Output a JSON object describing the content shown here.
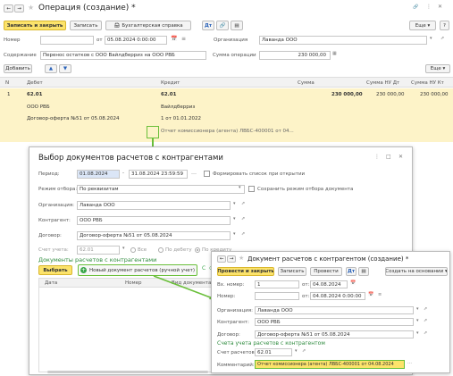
{
  "main": {
    "title": "Операция (создание) *",
    "nav": {
      "back": "←",
      "forward": "→",
      "star": "★"
    },
    "window_icons": {
      "link": "🔗",
      "more": "⋮",
      "close": "✕"
    },
    "toolbar": {
      "save_close": "Записать и закрыть",
      "save": "Записать",
      "acc_ref": "Бухгалтерская справка",
      "more": "Еще",
      "help": "?"
    },
    "number_label": "Номер",
    "from_label": "от",
    "date_value": "05.08.2024 0:00:00",
    "org_label": "Организация",
    "org_value": "Лаванда ООО",
    "content_label": "Содержание",
    "content_value": "Перенос остатков с ООО Вайлдберриз на ООО РВБ",
    "amount_label": "Сумма операции",
    "amount_value": "230 000,00",
    "add_button": "Добавить",
    "more2": "Еще",
    "table": {
      "headers": [
        "N",
        "Дебет",
        "Кредит",
        "Сумма",
        "Сумма НУ Дт",
        "Сумма НУ Кт"
      ],
      "row": {
        "n": "1",
        "debit": [
          "62.01",
          "ООО РВБ",
          "Договор-оферта №51 от 05.08.2024"
        ],
        "credit": [
          "62.01",
          "Вайлдберриз",
          "1 от 01.01.2022",
          "Отчет комиссионера (агента) ЛВБС-400001 от 04..."
        ],
        "sum": "230 000,00",
        "sum_dt": "230 000,00",
        "sum_kt": "230 000,00"
      }
    }
  },
  "dialog": {
    "title": "Выбор документов расчетов с контрагентами",
    "period_label": "Период:",
    "period_from": "01.08.2024",
    "period_to": "31.08.2024 23:59:59",
    "form_list_label": "Формировать список при открытии",
    "mode_label": "Режим отбора:",
    "mode_value": "По реквизитам",
    "save_mode_label": "Сохранить режим отбора документа",
    "org_label": "Организация:",
    "org_value": "Лаванда ООО",
    "contractor_label": "Контрагент:",
    "contractor_value": "ООО РВБ",
    "contract_label": "Договор:",
    "contract_value": "Договор-оферта №51 от 05.08.2024",
    "account_label": "Счет учета:",
    "account_value": "62.01",
    "radio_all": "Все",
    "radio_debit": "По дебету",
    "radio_credit": "По кредиту",
    "section": "Документы расчетов с контрагентами",
    "select_button": "Выбрать",
    "new_doc_button": "Новый документ расчетов (ручной учет)",
    "table_headers": [
      "Дата",
      "Номер",
      "Вид документа"
    ]
  },
  "doc": {
    "title": "Документ расчетов с контрагентом (создание) *",
    "save_close": "Провести и закрыть",
    "save": "Записать",
    "post": "Провести",
    "create_based": "Создать на основании",
    "in_number_label": "Вх. номер:",
    "in_number_value": "1",
    "from_label": "от:",
    "in_date": "04.08.2024",
    "number_label": "Номер:",
    "date_value": "04.08.2024  0:00:00",
    "org_label": "Организация:",
    "org_value": "Лаванда ООО",
    "contractor_label": "Контрагент:",
    "contractor_value": "ООО РВБ",
    "contract_label": "Договор:",
    "contract_value": "Договор-оферта №51 от 05.08.2024",
    "section": "Счета учета расчетов с контрагентом",
    "account_label": "Счет расчетов:",
    "account_value": "62.01",
    "comment_label": "Комментарий:",
    "comment_value": "Отчет комиссионера (агента) ЛВБС-400001 от 04.08.2024"
  },
  "colors": {
    "accent_green": "#6abf3a",
    "yellow": "#fce36b",
    "row_bg": "#fdf3c8",
    "link_green": "#2e8b3e"
  }
}
